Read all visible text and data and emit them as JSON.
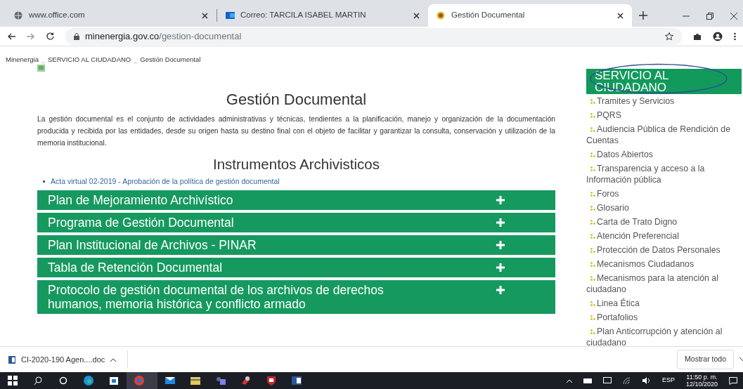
{
  "browser": {
    "tabs": [
      {
        "title": "www.office.com",
        "kind": "globe",
        "selected": false
      },
      {
        "title": "Correo: TARCILA ISABEL MARTIN",
        "kind": "mail",
        "selected": false
      },
      {
        "title": "Gestión Documental",
        "kind": "crest",
        "selected": true
      }
    ],
    "url_host": "minenergia.gov.co",
    "url_path": "/gestion-documental"
  },
  "page": {
    "breadcrumb": [
      "Minenergia",
      "SERVICIO AL CIUDADANO",
      "Gestión Documental"
    ],
    "title": "Gestión Documental",
    "intro": "La gestión documental es el conjunto de actividades administrativas y técnicas, tendientes a la planificación, manejo y organización de la documentación producida y recibida por las entidades, desde su origen hasta su destino final con el objeto de facilitar y garantizar la consulta, conservación y utilización de la memoria institucional.",
    "section_title": "Instrumentos Archivisticos",
    "links": [
      "Acta virtual 02-2019 - Aprobación de la política de gestión documental"
    ],
    "accordion": [
      {
        "title": "Plan de Mejoramiento Archivístico",
        "expanded": false
      },
      {
        "title": "Programa de Gestión Documental",
        "expanded": false
      },
      {
        "title": "Plan Institucional de Archivos - PINAR",
        "expanded": false
      },
      {
        "title": "Tabla de Retención Documental",
        "expanded": false
      },
      {
        "title": "Protocolo de gestión documental de los archivos de derechos humanos, memoria histórica y conflicto armado",
        "expanded": false
      }
    ],
    "sidebar": {
      "title": "SERVICIO AL CIUDADANO",
      "items": [
        "Tramites y Servicios",
        "PQRS",
        "Audiencia Pública de Rendición de Cuentas",
        "Datos Abiertos",
        "Transparencia y acceso a la Información pública",
        "Foros",
        "Glosario",
        "Carta de Trato Digno",
        "Atención Preferencial",
        "Protección de Datos Personales",
        "Mecanismos Ciudadanos",
        "Mecanismos para la atención al ciudadano",
        "Linea Ética",
        "Portafolios",
        "Plan Anticorrupción y atención al ciudadano"
      ]
    }
  },
  "downloads": {
    "items": [
      "CI-2020-190 Agen....doc"
    ],
    "show_all": "Mostrar todo"
  },
  "taskbar": {
    "language": "ESP",
    "time": "11:50 p. m.",
    "date": "12/10/2020"
  }
}
